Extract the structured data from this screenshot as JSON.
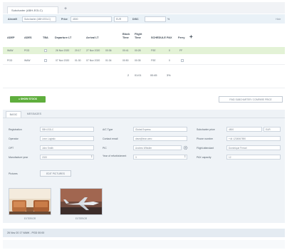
{
  "tab": {
    "title": "Subcharter (ABH-EGLC)",
    "add_label": "+"
  },
  "toprow": {
    "aircraft_label": "Aircraft",
    "aircraft_value": "Subcharter (ABH-EGLC)",
    "price_label": "Price",
    "price_value": "4500",
    "currency": "EUR",
    "disc_label": "DISC",
    "disc_unit": "%",
    "right_tag": "Hide"
  },
  "table": {
    "headers": [
      "ADEP",
      "ADES",
      "TBA",
      "Departure LT",
      "Arrival LT",
      "Block Time",
      "Flight Time",
      "SCHEDULE",
      "PAX",
      "Ferry"
    ],
    "add_label": "+",
    "rows": [
      [
        "WAW",
        "PGD",
        "",
        "26 Nov 2020",
        "20:17",
        "27 Nov 2020",
        "00:36",
        "00:41",
        "00:28",
        "FSE",
        "0",
        "FF"
      ],
      [
        "PGD",
        "WAW",
        "",
        "07 Nov 2020",
        "01:30",
        "07 Nov 2020",
        "01:34",
        "00:50",
        "00:35",
        "FSE",
        "0",
        ""
      ]
    ],
    "totals": [
      "2",
      "01:01",
      "00:45",
      "3%"
    ]
  },
  "buttons": {
    "show_stock": "● SHOW STOCK",
    "subcharter_link": "FIND SUBCHARTER / COMPARE PRICE"
  },
  "subtabs": [
    "BASIC",
    "MESSAGES"
  ],
  "form": {
    "registration_label": "Registration",
    "registration_value": "SBH-EGLC",
    "actype_label": "A/C Type",
    "actype_value": "Global Express",
    "subcharter_price_label": "Subcharter price",
    "subcharter_price_value": "4500",
    "subcharter_currency": "EUR",
    "operator_label": "Operator",
    "operator_value": "Leon Logistic",
    "contact_email_label": "Contact email",
    "contact_email_value": "dave@leon.aero",
    "phone_label": "Phone number",
    "phone_value": "+44 1234567890",
    "opt_label": "OPT",
    "opt_value": "John Smith",
    "pic_label": "PIC",
    "pic_value": "Andrew Whistler",
    "flight_attendant_label": "Flight attendant",
    "flight_attendant_value": "Dominique Ferrari",
    "manufacture_label": "Manufacture year",
    "manufacture_value": "2020",
    "refurbishment_label": "Year of refurbishment",
    "refurbishment_value": "3",
    "pax_capacity_label": "PAX capacity",
    "pax_capacity_value": "12",
    "pictures_label": "Pictures",
    "edit_pictures": "EDIT PICTURES",
    "pictures": [
      {
        "caption": "EXTERIOR"
      },
      {
        "caption": "EXTERIOR"
      }
    ]
  },
  "footer": {
    "text": "26 Nov  20 17 WAW - PGD 00:00"
  },
  "colors": {
    "accent_green": "#5fae3d",
    "row_green": "#e3f2d6",
    "panel": "#eff3f7"
  }
}
